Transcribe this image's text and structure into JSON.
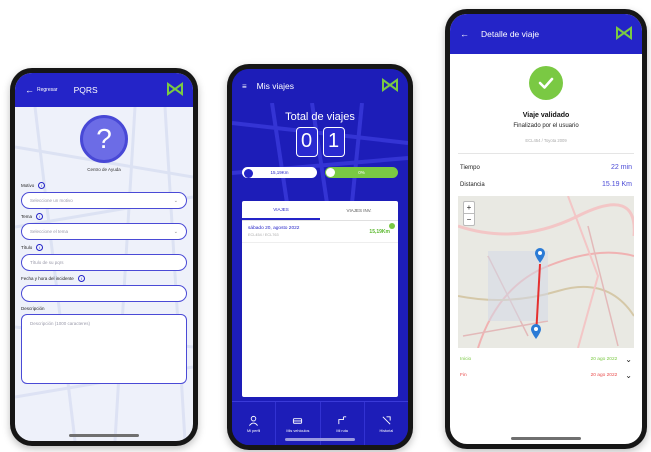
{
  "colors": {
    "primary": "#2424c8",
    "success": "#7ac943",
    "danger": "#e84a4a"
  },
  "phone1": {
    "back_label": "Regresar",
    "title": "PQRS",
    "help_label": "Centro de Ayuda",
    "fields": [
      {
        "label": "Motivo",
        "placeholder": "Seleccione un motivo",
        "dropdown": true
      },
      {
        "label": "Tema",
        "placeholder": "Seleccione el tema",
        "dropdown": true
      },
      {
        "label": "Título",
        "placeholder": "Título de su pqrs",
        "dropdown": false
      },
      {
        "label": "Fecha y hora del incidente",
        "placeholder": "",
        "dropdown": false
      }
    ],
    "description_label": "Descripción",
    "description_placeholder": "Descripción (1000 caracteres)"
  },
  "phone2": {
    "title": "Mis viajes",
    "total_label": "Total de viajes",
    "digits": [
      "0",
      "1"
    ],
    "pill_km": "15,19Km",
    "pill_percent": "0%",
    "tabs": [
      "VIAJES",
      "VIAJES INV."
    ],
    "trip": {
      "date": "sábado 20, agosto 2022",
      "sub": "ECL454 / ECL763",
      "km": "15,19Km"
    },
    "nav": [
      "Mi perfil",
      "Mis vehículos",
      "Mi ruta",
      "Historial"
    ]
  },
  "phone3": {
    "title": "Detalle de viaje",
    "status_title": "Viaje validado",
    "status_sub": "Finalizado por el usuario",
    "code": "ECL454 / Toyota 2009",
    "time_label": "Tiempo",
    "time_value": "22 min",
    "distance_label": "Distancia",
    "distance_value": "15.19 Km",
    "start_label": "Inicio",
    "start_date": "20 ago 2022",
    "end_label": "Fin",
    "end_date": "20 ago 2022"
  }
}
